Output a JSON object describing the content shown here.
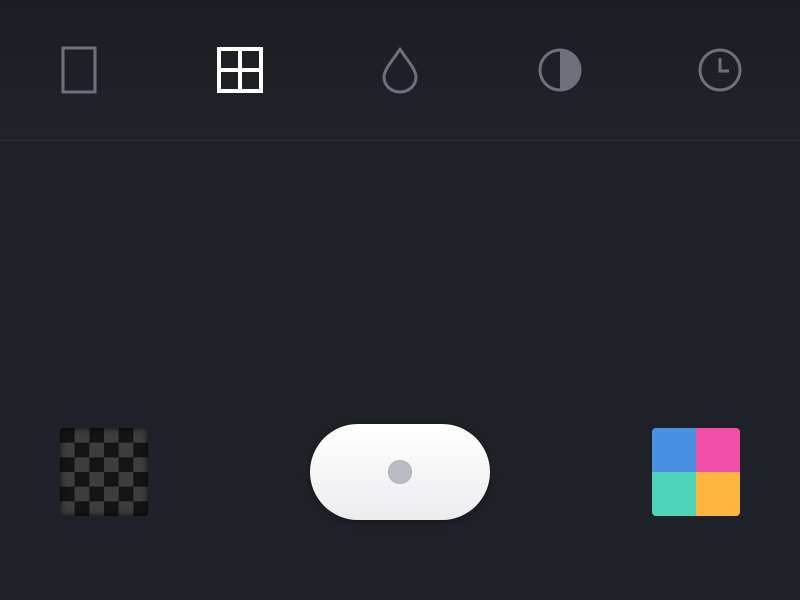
{
  "toolbar": {
    "items": [
      {
        "name": "frame",
        "icon": "frame-icon",
        "active": false
      },
      {
        "name": "grid",
        "icon": "grid-icon",
        "active": true
      },
      {
        "name": "drop",
        "icon": "drop-icon",
        "active": false
      },
      {
        "name": "contrast",
        "icon": "contrast-icon",
        "active": false
      },
      {
        "name": "timer",
        "icon": "clock-icon",
        "active": false
      }
    ],
    "active_color": "#ffffff",
    "inactive_color": "#6e717b"
  },
  "bottom_bar": {
    "left_swatch": {
      "icon": "checkerboard-icon",
      "colors": [
        "#141414",
        "#3e3e3e"
      ]
    },
    "shutter": {
      "icon": "shutter-button",
      "dot_color": "#b9bcc6"
    },
    "right_swatch": {
      "icon": "color-palette-icon",
      "colors": [
        "#4a90e2",
        "#f04fa8",
        "#4fd3b8",
        "#ffb540"
      ]
    }
  },
  "colors": {
    "background": "#1f2128",
    "toolbar_divider": "#2b2e36"
  }
}
